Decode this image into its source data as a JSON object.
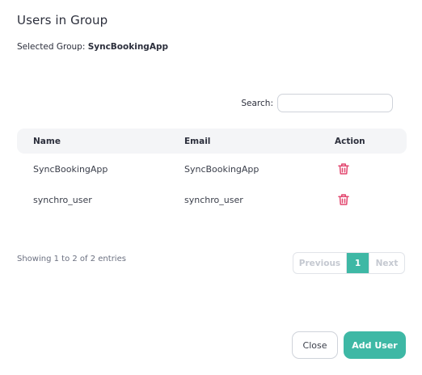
{
  "dialog": {
    "title": "Users in Group",
    "selected_label": "Selected Group:",
    "selected_group": "SyncBookingApp"
  },
  "search": {
    "label": "Search:",
    "value": "",
    "placeholder": ""
  },
  "table": {
    "headers": {
      "name": "Name",
      "email": "Email",
      "action": "Action"
    },
    "rows": [
      {
        "name": "SyncBookingApp",
        "email": "SyncBookingApp",
        "action_icon": "trash-icon"
      },
      {
        "name": "synchro_user",
        "email": "synchro_user",
        "action_icon": "trash-icon"
      }
    ]
  },
  "pagination": {
    "info": "Showing 1 to 2 of 2 entries",
    "previous": "Previous",
    "current_page": "1",
    "next": "Next"
  },
  "footer": {
    "close_label": "Close",
    "add_user_label": "Add User"
  },
  "colors": {
    "accent": "#3eb8a5",
    "danger": "#e2476f",
    "header_bg": "#f4f5f7"
  }
}
